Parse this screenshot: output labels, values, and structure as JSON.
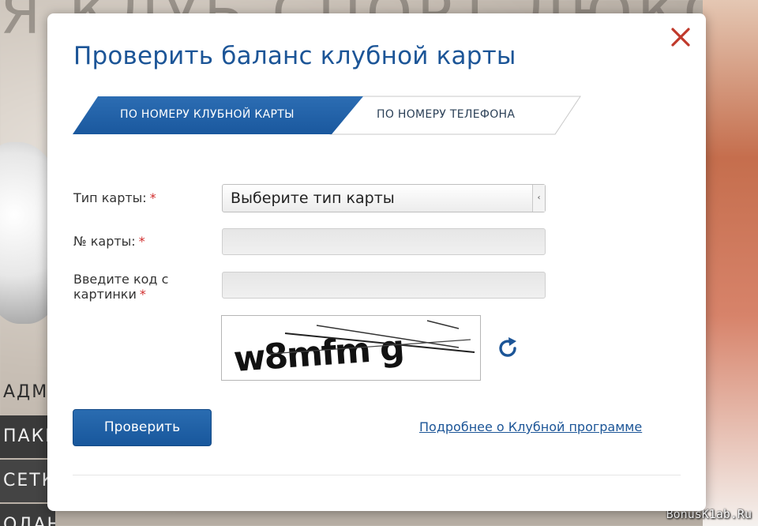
{
  "background": {
    "hero_text": "Я КЛУБ СПОРТ ЛЮКС",
    "menu_items": [
      "АДМИН",
      "ПАКЕТ",
      "СЕТКИ",
      "ОДАНЫ"
    ],
    "watermark": "BonusK1ab.Ru"
  },
  "modal": {
    "title": "Проверить баланс клубной карты",
    "close_icon": "close-icon",
    "tabs": [
      {
        "label": "ПО НОМЕРУ КЛУБНОЙ КАРТЫ",
        "active": true
      },
      {
        "label": "ПО НОМЕРУ ТЕЛЕФОНА",
        "active": false
      }
    ],
    "form": {
      "card_type_label": "Тип карты:",
      "card_type_value": "Выберите тип карты",
      "card_number_label": "№ карты:",
      "captcha_label_line1": "Введите код с",
      "captcha_label_line2": "картинки",
      "required_mark": "*",
      "captcha_text": "w8mfm g",
      "refresh_icon": "refresh-icon"
    },
    "submit_label": "Проверить",
    "more_link": "Подробнее о Клубной программе"
  },
  "colors": {
    "brand_blue": "#1c5597",
    "close_red": "#c0392b",
    "required_red": "#d12c2c"
  }
}
